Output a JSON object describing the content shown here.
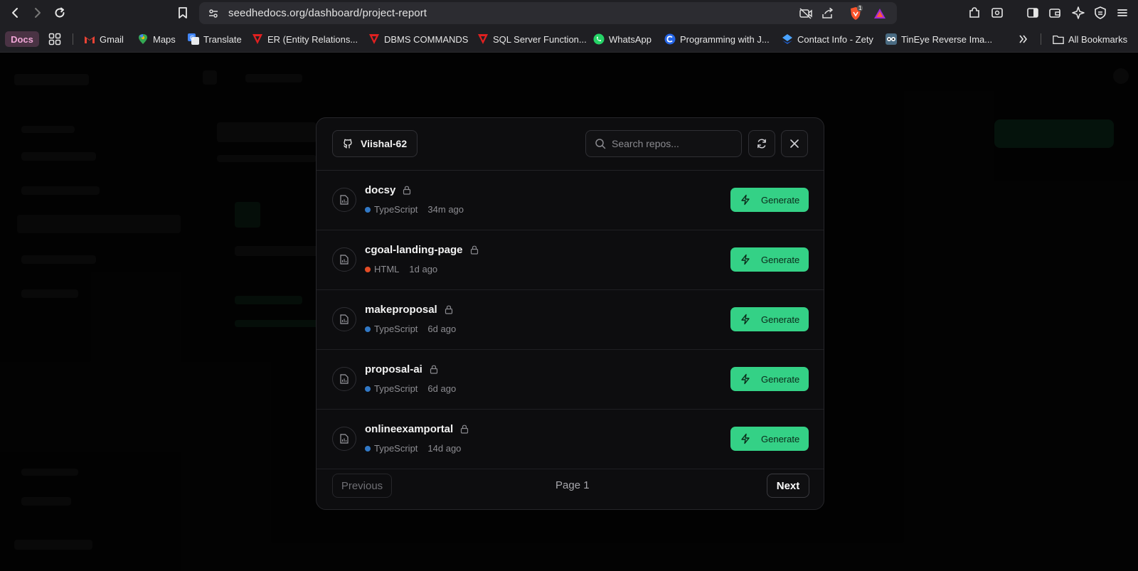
{
  "browser": {
    "url": "seedhedocs.org/dashboard/project-report",
    "brave_badge_count": "1"
  },
  "bookmarks": {
    "docs_label": "Docs",
    "items": [
      {
        "label": "Gmail",
        "icon": "gmail-icon"
      },
      {
        "label": "Maps",
        "icon": "maps-icon"
      },
      {
        "label": "Translate",
        "icon": "translate-icon"
      },
      {
        "label": "ER (Entity Relations...",
        "icon": "red-shield-icon"
      },
      {
        "label": "DBMS COMMANDS",
        "icon": "red-shield-icon"
      },
      {
        "label": "SQL Server Function...",
        "icon": "red-shield-icon"
      },
      {
        "label": "WhatsApp",
        "icon": "whatsapp-icon"
      },
      {
        "label": "Programming with J...",
        "icon": "c-circle-icon"
      },
      {
        "label": "Contact Info - Zety",
        "icon": "zety-icon"
      },
      {
        "label": "TinEye Reverse Ima...",
        "icon": "tineye-icon"
      }
    ],
    "all_bookmarks": "All Bookmarks"
  },
  "modal": {
    "user": "Viishal-62",
    "search_placeholder": "Search repos...",
    "repos": [
      {
        "name": "docsy",
        "language": "TypeScript",
        "lang_color": "#3178c6",
        "updated": "34m ago",
        "action": "Generate"
      },
      {
        "name": "cgoal-landing-page",
        "language": "HTML",
        "lang_color": "#e34c26",
        "updated": "1d ago",
        "action": "Generate"
      },
      {
        "name": "makeproposal",
        "language": "TypeScript",
        "lang_color": "#3178c6",
        "updated": "6d ago",
        "action": "Generate"
      },
      {
        "name": "proposal-ai",
        "language": "TypeScript",
        "lang_color": "#3178c6",
        "updated": "6d ago",
        "action": "Generate"
      },
      {
        "name": "onlineexamportal",
        "language": "TypeScript",
        "lang_color": "#3178c6",
        "updated": "14d ago",
        "action": "Generate"
      }
    ],
    "pagination": {
      "previous": "Previous",
      "page_label": "Page 1",
      "next": "Next"
    }
  }
}
